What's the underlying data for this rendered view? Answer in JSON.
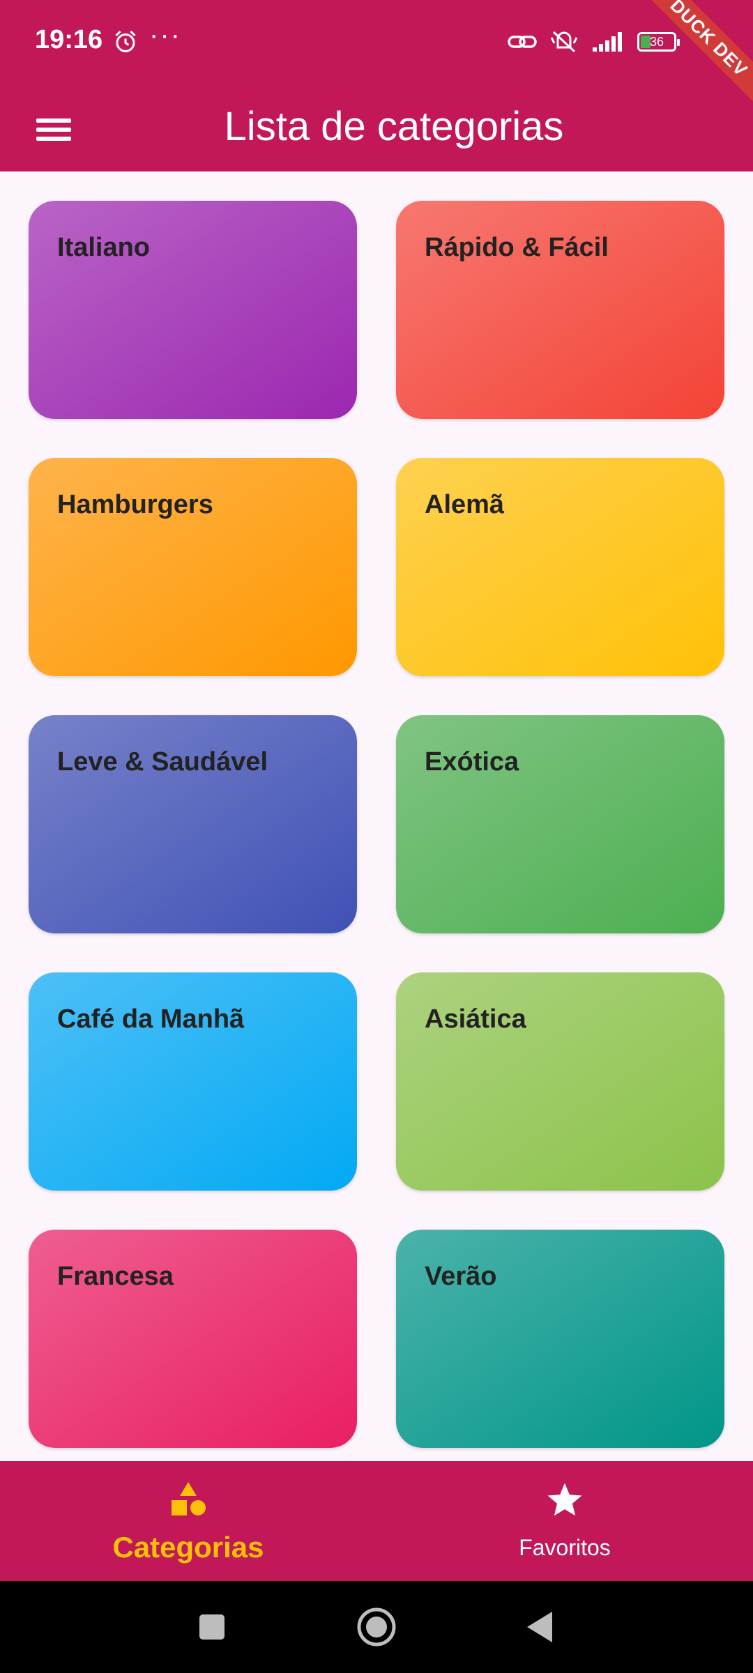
{
  "status_bar": {
    "time": "19:16",
    "battery_level": "36",
    "icons": [
      "alarm-icon",
      "more-dots-icon",
      "link-icon",
      "mute-icon",
      "signal-icon",
      "battery-icon"
    ]
  },
  "debug_banner": "DUCK DEV",
  "app_bar": {
    "title": "Lista de categorias",
    "menu_icon": "hamburger-menu-icon"
  },
  "categories": [
    {
      "label": "Italiano",
      "color": "#9c27b0"
    },
    {
      "label": "Rápido & Fácil",
      "color": "#f44336"
    },
    {
      "label": "Hamburgers",
      "color": "#ff9800"
    },
    {
      "label": "Alemã",
      "color": "#ffc107"
    },
    {
      "label": "Leve & Saudável",
      "color": "#3f51b5"
    },
    {
      "label": "Exótica",
      "color": "#4caf50"
    },
    {
      "label": "Café da Manhã",
      "color": "#03a9f4"
    },
    {
      "label": "Asiática",
      "color": "#8bc34a"
    },
    {
      "label": "Francesa",
      "color": "#e91e63"
    },
    {
      "label": "Verão",
      "color": "#009688"
    }
  ],
  "bottom_nav": {
    "items": [
      {
        "label": "Categorias",
        "icon": "category-shapes-icon",
        "active": true
      },
      {
        "label": "Favoritos",
        "icon": "star-icon",
        "active": false
      }
    ]
  },
  "colors": {
    "primary": "#c21857",
    "accent": "#ffc107",
    "background": "#fcf5fb"
  }
}
